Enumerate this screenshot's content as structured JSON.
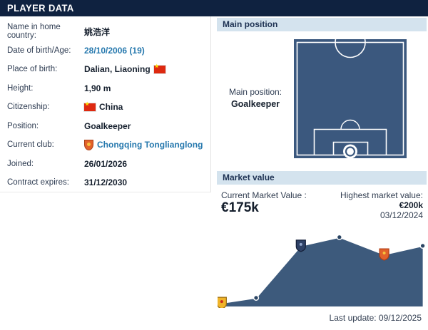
{
  "page": {
    "title": "PLAYER DATA"
  },
  "player_data": {
    "rows": [
      {
        "label": "Name in home country:",
        "value": "姚浩洋"
      },
      {
        "label": "Date of birth/Age:",
        "value": "28/10/2006 (19)"
      },
      {
        "label": "Place of birth:",
        "value": "Dalian, Liaoning"
      },
      {
        "label": "Height:",
        "value": "1,90 m"
      },
      {
        "label": "Citizenship:",
        "value": "China"
      },
      {
        "label": "Position:",
        "value": "Goalkeeper"
      },
      {
        "label": "Current club:",
        "value": "Chongqing Tonglianglong"
      },
      {
        "label": "Joined:",
        "value": "26/01/2026"
      },
      {
        "label": "Contract expires:",
        "value": "31/12/2030"
      }
    ]
  },
  "main_position": {
    "header": "Main position",
    "label": "Main position:",
    "value": "Goalkeeper"
  },
  "market_value": {
    "header": "Market value",
    "current_label": "Current Market Value :",
    "current_value": "€175k",
    "highest_label": "Highest market value:",
    "highest_value": "€200k",
    "highest_date": "03/12/2024",
    "last_update": "Last update: 09/12/2025"
  },
  "chart_data": {
    "type": "area",
    "title": "Market value over time",
    "unit": "€k",
    "values": [
      10,
      25,
      175,
      200,
      150,
      175
    ],
    "ymax": 220,
    "x_fractions": [
      0.02,
      0.185,
      0.4,
      0.585,
      0.8,
      0.985
    ],
    "dots": [
      1,
      3,
      5
    ],
    "markers": [
      {
        "index": 0,
        "type": "crest-gold"
      },
      {
        "index": 2,
        "type": "crest-navy"
      },
      {
        "index": 4,
        "type": "crest-orange"
      }
    ],
    "legend": "none",
    "grid": false
  },
  "colors": {
    "navy_bar": "#0f2240",
    "panel_header_bg": "#d4e3ee",
    "pitch_fill": "#3b587e",
    "chart_fill": "#3d5a7c",
    "link": "#2779ae",
    "flag_red": "#de2910",
    "crest_orange": "#e2622b",
    "crest_gold": "#f0b429",
    "crest_navy": "#2e4166"
  }
}
